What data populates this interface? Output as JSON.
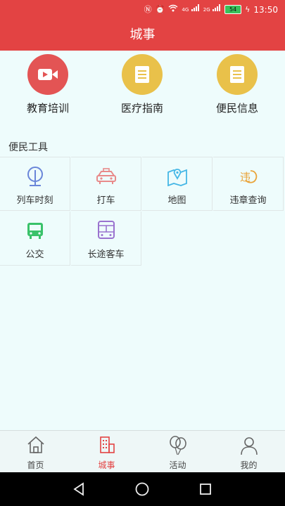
{
  "status_bar": {
    "time": "13:50",
    "battery": "54",
    "network_1": "4G",
    "network_2": "2G",
    "icons": [
      "nfc-icon",
      "alarm-icon",
      "wifi-icon",
      "signal-icon",
      "signal-icon",
      "battery-icon",
      "charging-icon"
    ]
  },
  "header": {
    "title": "城事"
  },
  "services": [
    {
      "label": "教育培训",
      "icon": "video-camera-icon",
      "color": "#e35454"
    },
    {
      "label": "医疗指南",
      "icon": "document-icon",
      "color": "#e9c14a"
    },
    {
      "label": "便民信息",
      "icon": "document-icon",
      "color": "#e9c14a"
    }
  ],
  "tools": {
    "title": "便民工具",
    "items": [
      {
        "label": "列车时刻",
        "icon": "train-icon",
        "color": "#6a86d9"
      },
      {
        "label": "打车",
        "icon": "taxi-icon",
        "color": "#e88a8a"
      },
      {
        "label": "地图",
        "icon": "map-icon",
        "color": "#45b7e6"
      },
      {
        "label": "违章查询",
        "icon": "violation-icon",
        "color": "#e9a43a"
      },
      {
        "label": "公交",
        "icon": "bus-icon",
        "color": "#3ac26a"
      },
      {
        "label": "长途客车",
        "icon": "coach-icon",
        "color": "#9a72cf"
      }
    ]
  },
  "tabbar": {
    "items": [
      {
        "label": "首页",
        "icon": "home-icon",
        "active": false
      },
      {
        "label": "城事",
        "icon": "building-icon",
        "active": true
      },
      {
        "label": "活动",
        "icon": "balloons-icon",
        "active": false
      },
      {
        "label": "我的",
        "icon": "user-icon",
        "active": false
      }
    ],
    "active_color": "#e34343"
  },
  "nav_bar": {
    "icons": [
      "back-icon",
      "home-circle-icon",
      "recents-icon"
    ]
  }
}
